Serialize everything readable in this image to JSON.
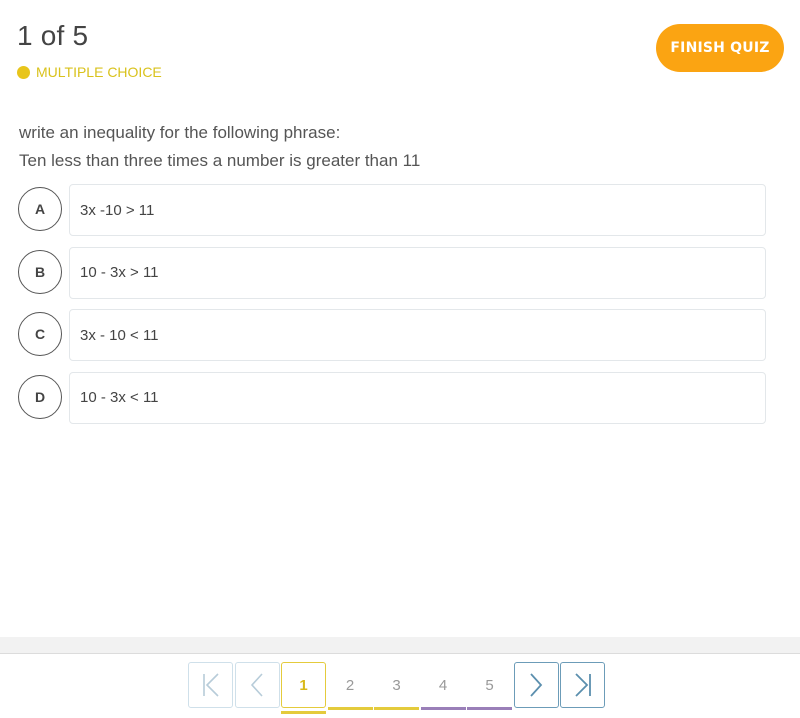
{
  "header": {
    "counter": "1 of 5",
    "question_type": "MULTIPLE CHOICE",
    "question_type_color": "#e8c51b",
    "finish_label": "FINISH QUIZ",
    "finish_color": "#fba412"
  },
  "question": {
    "line1": "write an inequality for the following phrase:",
    "line2": "Ten less than three times a number is greater than 11"
  },
  "options": [
    {
      "letter": "A",
      "text": "3x -10 > 11"
    },
    {
      "letter": "B",
      "text": "10 - 3x > 11"
    },
    {
      "letter": "C",
      "text": "3x - 10 < 11"
    },
    {
      "letter": "D",
      "text": "10 - 3x < 11"
    }
  ],
  "pagination": {
    "first_icon": "first-page-icon",
    "prev_icon": "prev-page-icon",
    "next_icon": "next-page-icon",
    "last_icon": "last-page-icon",
    "current_page": 1,
    "pages": [
      {
        "label": "1",
        "indicator_color": "#e4cb3c"
      },
      {
        "label": "2",
        "indicator_color": "#e4cb3c"
      },
      {
        "label": "3",
        "indicator_color": "#e4cb3c"
      },
      {
        "label": "4",
        "indicator_color": "#9a7fb8"
      },
      {
        "label": "5",
        "indicator_color": "#9a7fb8"
      }
    ]
  }
}
